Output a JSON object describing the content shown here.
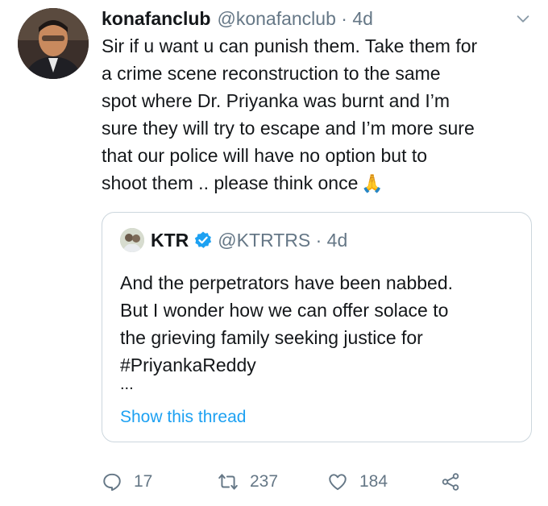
{
  "tweet": {
    "display_name": "konafanclub",
    "handle": "@konafanclub",
    "separator": " · ",
    "time": "4d",
    "text": "Sir if u want u can punish them. Take them for\na crime scene reconstruction to the same\nspot where Dr. Priyanka was burnt and I’m\nsure they will try to escape and I’m more sure\nthat our police will have no option but to\nshoot them .. please think once",
    "emoji": "🙏"
  },
  "quoted": {
    "display_name": "KTR",
    "handle": "@KTRTRS",
    "separator": " · ",
    "time": "4d",
    "text": "And the perpetrators have been nabbed.\nBut I wonder how we can offer solace to\nthe grieving family seeking justice for\n#PriyankaReddy",
    "ellipsis": "...",
    "show_thread": "Show this thread"
  },
  "actions": {
    "reply_count": "17",
    "retweet_count": "237",
    "like_count": "184"
  },
  "colors": {
    "accent": "#1da1f2",
    "secondary_text": "#657786",
    "border": "#ccd6dd"
  },
  "icons": [
    "chevron-down-icon",
    "verified-icon",
    "reply-icon",
    "retweet-icon",
    "like-icon",
    "share-icon"
  ]
}
